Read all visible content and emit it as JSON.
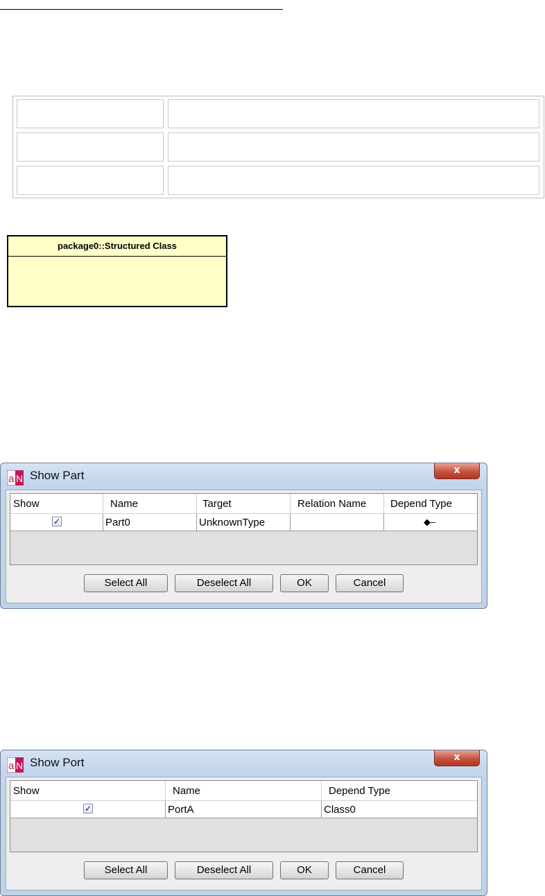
{
  "class_box": {
    "title": "package0::Structured Class"
  },
  "show_part_dialog": {
    "title": "Show Part",
    "close_label": "x",
    "columns": [
      "Show",
      "Name",
      "Target",
      "Relation Name",
      "Depend Type"
    ],
    "rows": [
      {
        "show": true,
        "name": "Part0",
        "target": "UnknownType",
        "relation_name": "",
        "depend_type_icon": "composition-diamond-icon"
      }
    ],
    "buttons": {
      "select_all": "Select All",
      "deselect_all": "Deselect All",
      "ok": "OK",
      "cancel": "Cancel"
    }
  },
  "show_port_dialog": {
    "title": "Show Port",
    "close_label": "x",
    "columns": [
      "Show",
      "Name",
      "Depend Type"
    ],
    "rows": [
      {
        "show": true,
        "name": "PortA",
        "depend_type": "Class0"
      }
    ],
    "buttons": {
      "select_all": "Select All",
      "deselect_all": "Deselect All",
      "ok": "OK",
      "cancel": "Cancel"
    }
  },
  "colors": {
    "class_fill": "#ffffc8",
    "dialog_frame": "#c3d6eb",
    "close_button": "#c5533f",
    "app_icon": "#c2185b"
  }
}
